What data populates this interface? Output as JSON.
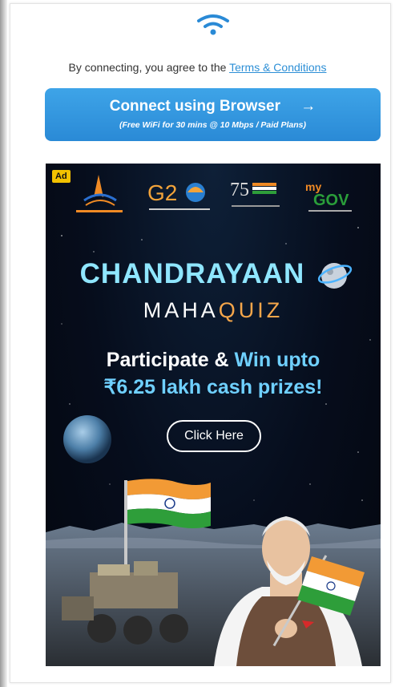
{
  "header": {
    "terms_prefix": "By connecting, you agree to the",
    "terms_link": "Terms & Conditions"
  },
  "connect": {
    "label": "Connect using Browser",
    "arrow": "→",
    "subtext_prefix": "(Free WiFi for ",
    "subtext_bold": "30 mins @ 10 Mbps",
    "subtext_suffix": " / Paid Plans)"
  },
  "ad": {
    "badge": "Ad",
    "logos": [
      "isro-logo",
      "g20-logo",
      "azadi-ka-amrit-mahotsav-logo",
      "mygov-logo"
    ],
    "title": "CHANDRAYAAN",
    "subtitle_a": "MAHA",
    "subtitle_b": "QUIZ",
    "promo_line1_a": "Participate & ",
    "promo_line1_b": "Win upto",
    "promo_line2": "₹6.25 lakh cash prizes!",
    "cta": "Click Here",
    "colors": {
      "title": "#8fe6ff",
      "accent_orange": "#f5a64a",
      "accent_blue": "#6fd0ff",
      "button_blue": "#2a8ad6"
    }
  }
}
